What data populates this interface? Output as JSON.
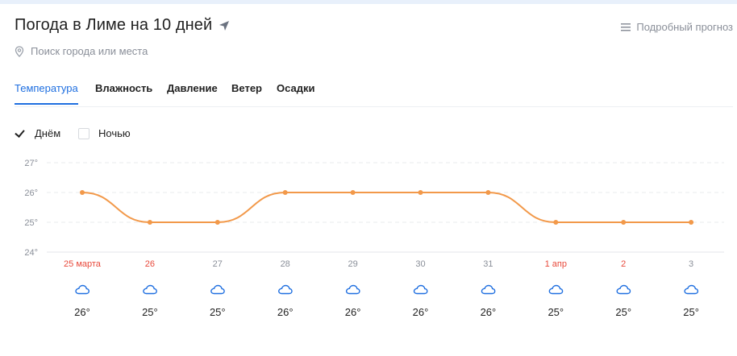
{
  "header": {
    "title": "Погода в Лиме на 10 дней",
    "detailed_label": "Подробный прогноз",
    "search_placeholder": "Поиск города или места"
  },
  "tabs": [
    {
      "label": "Температура",
      "active": true
    },
    {
      "label": "Влажность",
      "active": false
    },
    {
      "label": "Давление",
      "active": false
    },
    {
      "label": "Ветер",
      "active": false
    },
    {
      "label": "Осадки",
      "active": false
    }
  ],
  "toggles": {
    "day": {
      "label": "Днём",
      "checked": true
    },
    "night": {
      "label": "Ночью",
      "checked": false
    }
  },
  "colors": {
    "accent": "#1f6fe0",
    "line": "#f2994a",
    "weekend": "#e8493b",
    "muted": "#8a8f99"
  },
  "days": [
    {
      "label": "25 марта",
      "weekend": true,
      "temp": "26°",
      "icon": "cloud-icon"
    },
    {
      "label": "26",
      "weekend": true,
      "temp": "25°",
      "icon": "cloud-icon"
    },
    {
      "label": "27",
      "weekend": false,
      "temp": "25°",
      "icon": "cloud-icon"
    },
    {
      "label": "28",
      "weekend": false,
      "temp": "26°",
      "icon": "cloud-icon"
    },
    {
      "label": "29",
      "weekend": false,
      "temp": "26°",
      "icon": "cloud-icon"
    },
    {
      "label": "30",
      "weekend": false,
      "temp": "26°",
      "icon": "cloud-icon"
    },
    {
      "label": "31",
      "weekend": false,
      "temp": "26°",
      "icon": "cloud-icon"
    },
    {
      "label": "1 апр",
      "weekend": true,
      "temp": "25°",
      "icon": "cloud-icon"
    },
    {
      "label": "2",
      "weekend": true,
      "temp": "25°",
      "icon": "cloud-icon"
    },
    {
      "label": "3",
      "weekend": false,
      "temp": "25°",
      "icon": "cloud-icon"
    }
  ],
  "chart_data": {
    "type": "line",
    "categories": [
      "25 марта",
      "26",
      "27",
      "28",
      "29",
      "30",
      "31",
      "1 апр",
      "2",
      "3"
    ],
    "series": [
      {
        "values": [
          26,
          25,
          25,
          26,
          26,
          26,
          26,
          25,
          25,
          25
        ]
      }
    ],
    "y_ticks": [
      "27°",
      "26°",
      "25°",
      "24°"
    ],
    "ylim": [
      24,
      27
    ],
    "grid": true
  }
}
